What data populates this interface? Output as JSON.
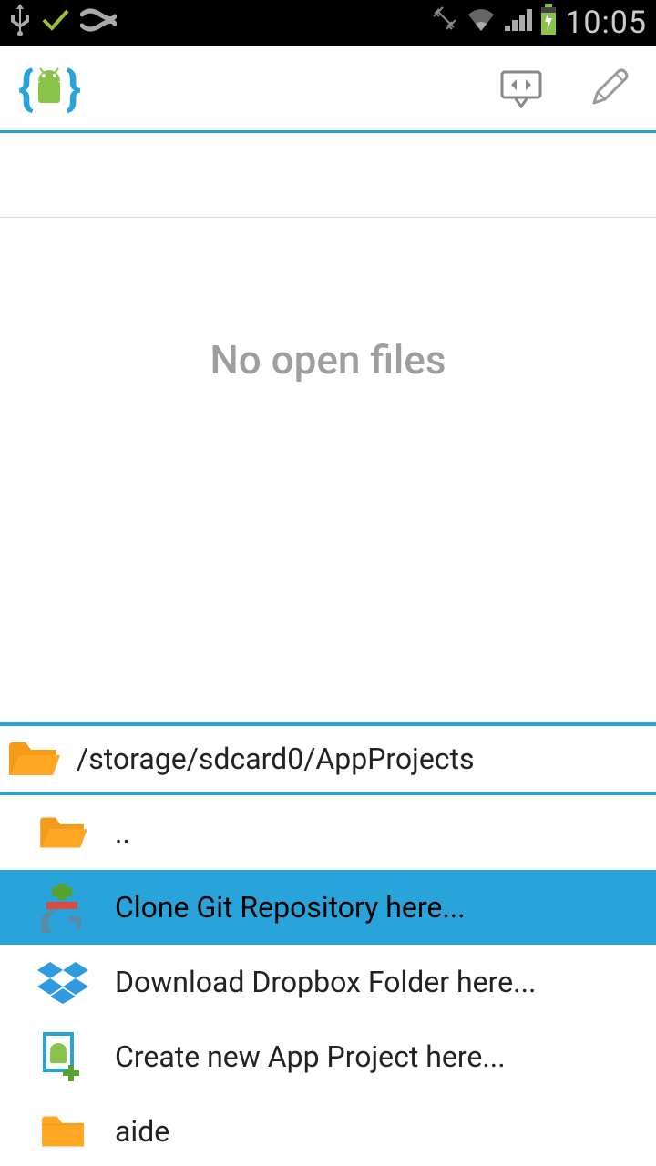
{
  "statusbar": {
    "time": "10:05"
  },
  "header": {},
  "editor": {
    "empty_message": "No open files"
  },
  "path": {
    "current": "/storage/sdcard0/AppProjects"
  },
  "files": {
    "items": [
      {
        "label": "..",
        "icon": "folder",
        "selected": false
      },
      {
        "label": "Clone Git Repository here...",
        "icon": "git",
        "selected": true
      },
      {
        "label": "Download Dropbox Folder here...",
        "icon": "dropbox",
        "selected": false
      },
      {
        "label": "Create new App Project here...",
        "icon": "newproject",
        "selected": false
      },
      {
        "label": "aide",
        "icon": "folder",
        "selected": false
      }
    ]
  }
}
